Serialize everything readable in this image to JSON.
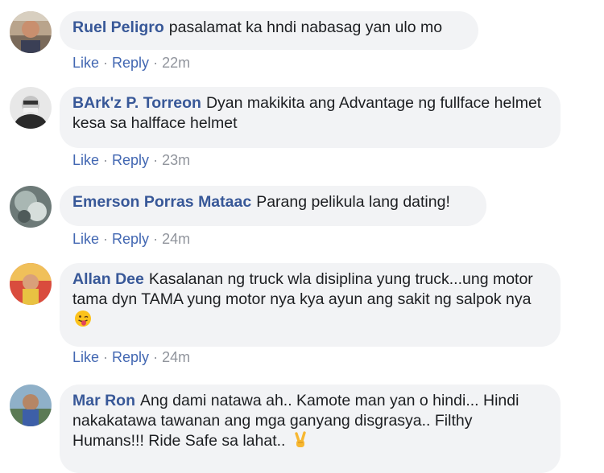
{
  "comments": [
    {
      "author": "Ruel Peligro",
      "text": "pasalamat ka hndi nabasag yan ulo mo",
      "like_label": "Like",
      "reply_label": "Reply",
      "separator": "·",
      "time": "22m",
      "avatar_icon": "profile-photo-icon"
    },
    {
      "author": "BArk'z P. Torreon",
      "text": "Dyan makikita ang Advantage ng fullface helmet kesa sa halfface helmet",
      "like_label": "Like",
      "reply_label": "Reply",
      "separator": "·",
      "time": "23m",
      "avatar_icon": "profile-photo-icon"
    },
    {
      "author": "Emerson Porras Mataac",
      "text": "Parang pelikula lang dating!",
      "like_label": "Like",
      "reply_label": "Reply",
      "separator": "·",
      "time": "24m",
      "avatar_icon": "profile-photo-icon"
    },
    {
      "author": "Allan Dee",
      "text": "Kasalanan ng truck wla disiplina yung truck...ung motor tama dyn TAMA yung motor nya kya ayun ang sakit ng salpok nya",
      "emoji": "tongue-out-emoji",
      "like_label": "Like",
      "reply_label": "Reply",
      "separator": "·",
      "time": "24m",
      "avatar_icon": "profile-photo-icon"
    },
    {
      "author": "Mar Ron",
      "text": "Ang dami natawa ah.. Kamote man yan o hindi... Hindi nakakatawa tawanan ang mga ganyang disgrasya.. Filthy Humans!!! Ride Safe sa lahat..",
      "emoji": "victory-hand-emoji",
      "avatar_icon": "profile-photo-icon"
    }
  ],
  "colors": {
    "author": "#385898",
    "action_link": "#4267b2",
    "meta": "#90949c",
    "bubble": "#f2f3f5",
    "text": "#1c1e21"
  }
}
